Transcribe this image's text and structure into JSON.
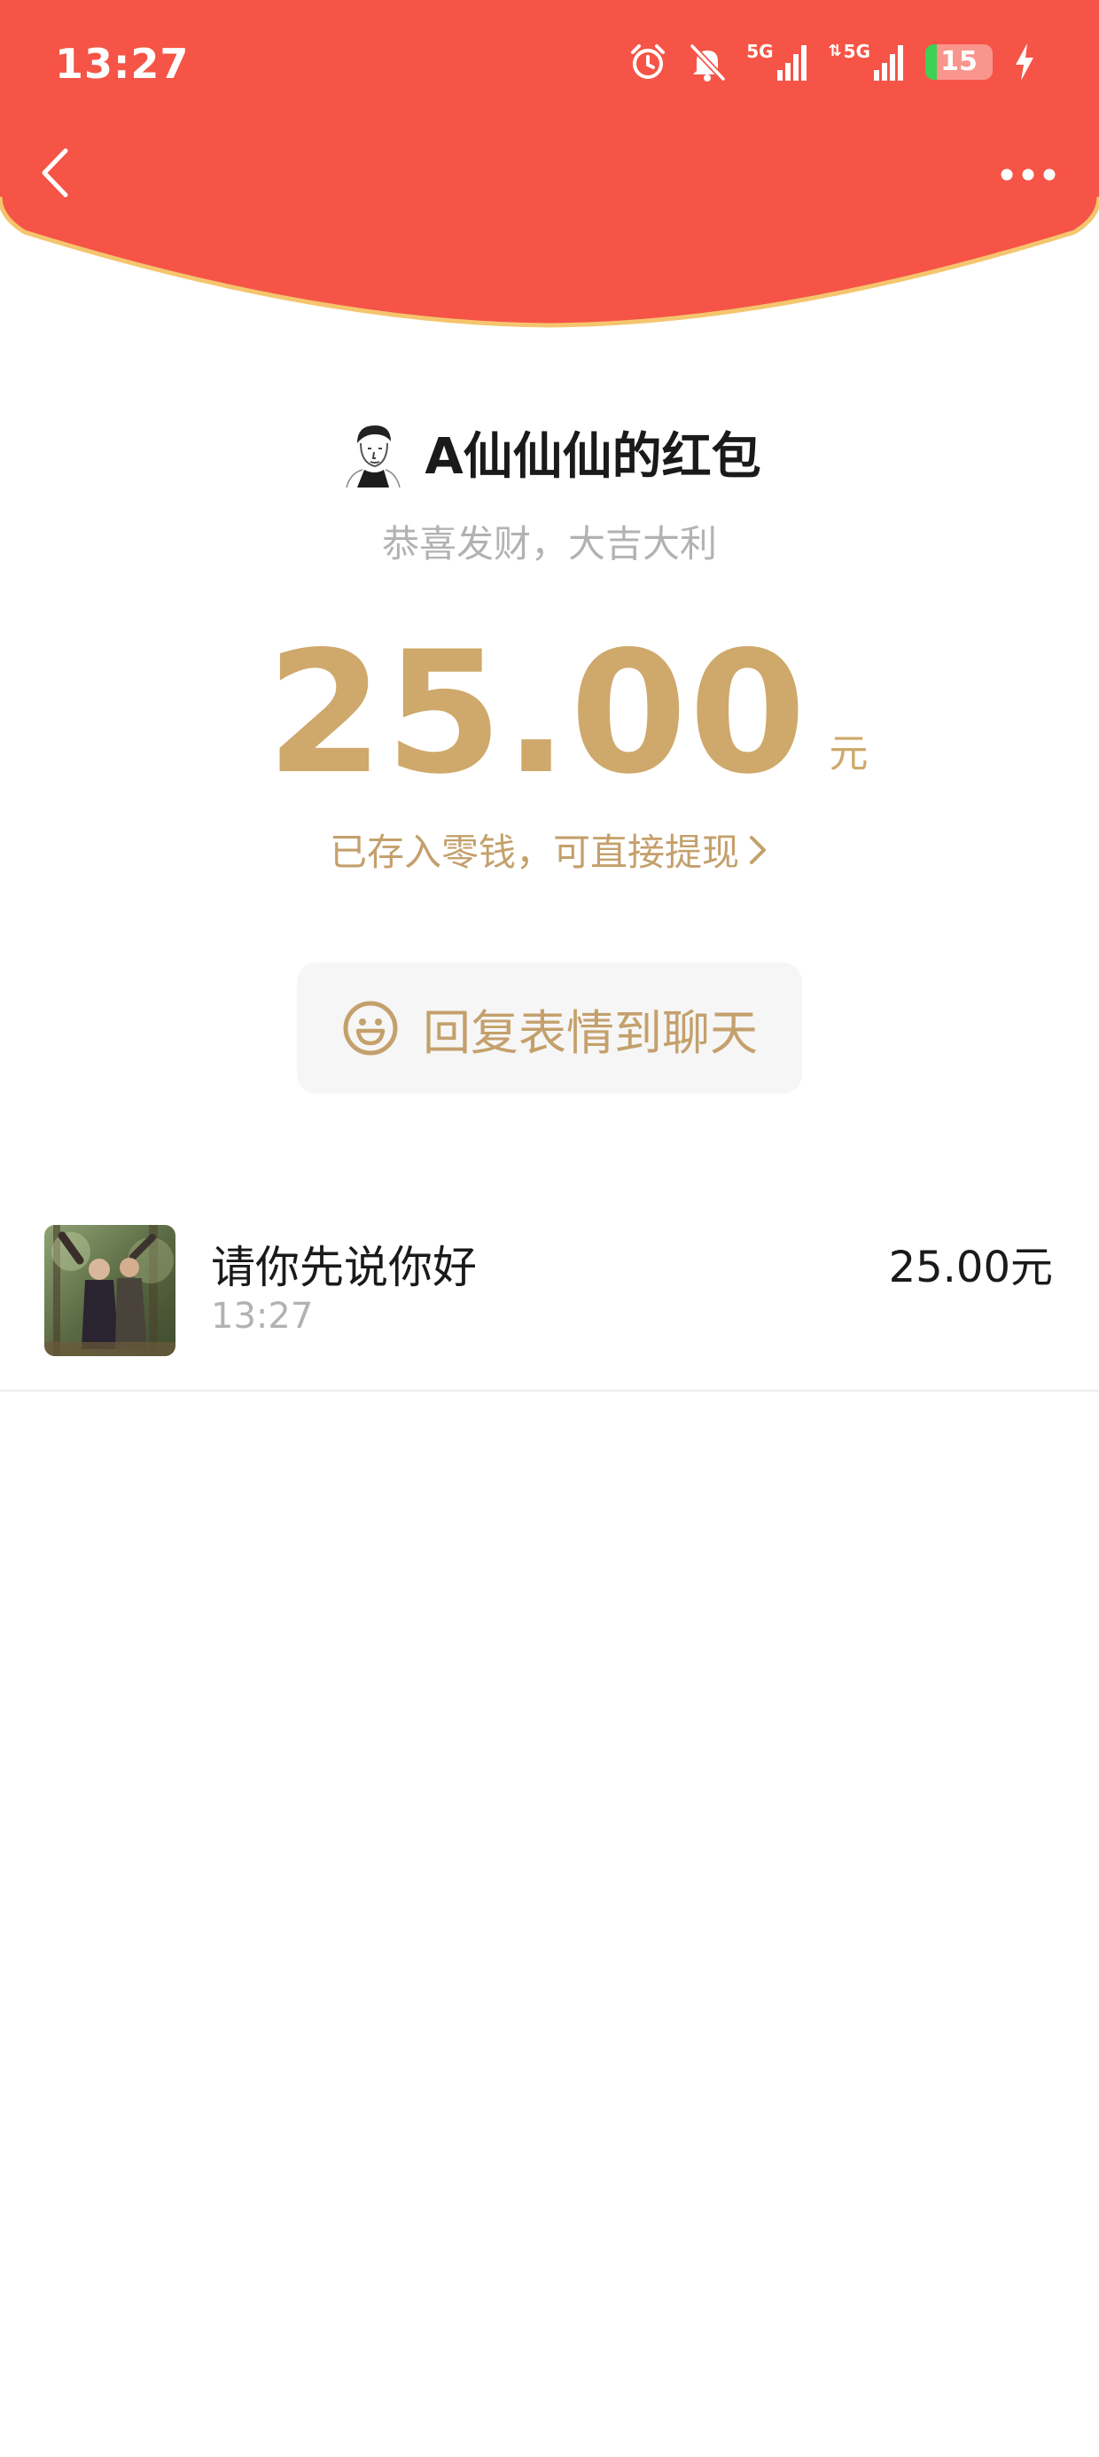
{
  "status_bar": {
    "time": "13:27",
    "network_1": "5G",
    "network_2": "5G",
    "battery_level": "15"
  },
  "nav": {
    "back_icon": "chevron-left-icon",
    "more_icon": "more-dots-icon"
  },
  "envelope": {
    "sender_title": "A仙仙仙的红包",
    "greeting": "恭喜发财，大吉大利",
    "amount": "25.00",
    "unit": "元",
    "change_notice": "已存入零钱，可直接提现"
  },
  "reply_button": {
    "icon": "smiley-icon",
    "label": "回复表情到聊天"
  },
  "records": [
    {
      "message": "请你先说你好",
      "time": "13:27",
      "amount": "25.00元"
    }
  ],
  "colors": {
    "header_red": "#f55446",
    "header_edge": "#f5c56e",
    "gold": "#cfa86b",
    "battery_green": "#3cd155"
  }
}
